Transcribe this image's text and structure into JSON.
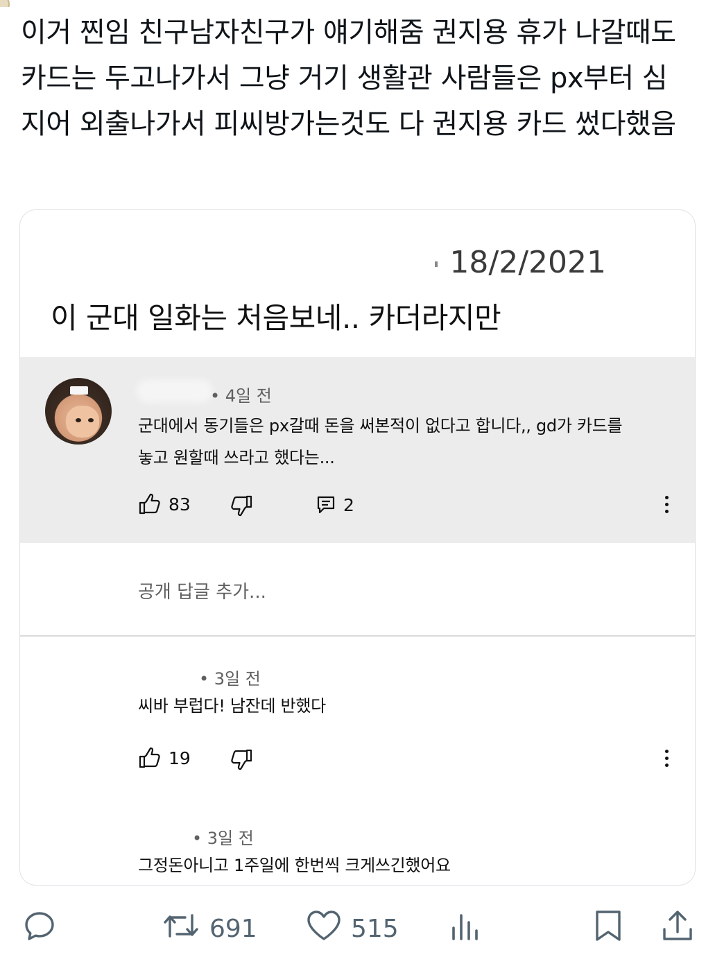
{
  "tweet": {
    "text": "이거 찐임 친구남자친구가 얘기해줌 권지용 휴가 나갈때도 카드는 두고나가서 그냥 거기 생활관 사람들은 px부터 심지어 외출나가서 피씨방가는것도 다 권지용 카드 썼다했음"
  },
  "quoted_post": {
    "date": "18/2/2021",
    "title": "이 군대 일화는 처음보네.. 카더라지만"
  },
  "comments": [
    {
      "time": "• 4일 전",
      "text_line1": "군대에서 동기들은 px갈때 돈을 써본적이 없다고 합니다,, gd가 카드를",
      "text_line2": "놓고 원할때 쓰라고 했다는...",
      "likes": "83",
      "replies": "2"
    },
    {
      "time": "• 3일 전",
      "text_line1": "씨바 부럽다! 남잔데 반했다",
      "likes": "19"
    },
    {
      "time": "• 3일 전",
      "text_line1": "그정돈아니고 1주일에 한번씩 크게쓰긴했어요"
    }
  ],
  "reply_placeholder": "공개 답글 추가...",
  "tweet_actions": {
    "retweets": "691",
    "likes": "515"
  },
  "colors": {
    "highlight_bg": "#ececec",
    "action_gray": "#536471"
  },
  "icons": [
    "reply-icon",
    "retweet-icon",
    "heart-icon",
    "views-icon",
    "bookmark-icon",
    "share-icon",
    "thumbs-up-icon",
    "thumbs-down-icon",
    "comment-icon",
    "more-vert-icon"
  ]
}
